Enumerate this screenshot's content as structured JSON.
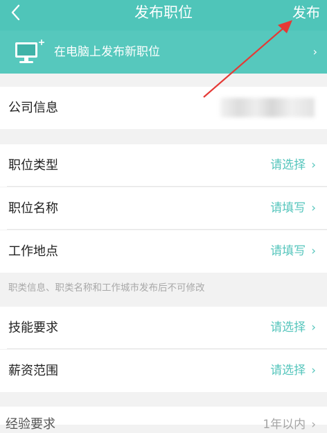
{
  "header": {
    "back_icon": "chevron-left-icon",
    "title": "发布职位",
    "publish_label": "发布"
  },
  "pc_banner": {
    "icon": "computer-monitor-icon",
    "text": "在电脑上发布新职位",
    "chevron": "›"
  },
  "company": {
    "label": "公司信息"
  },
  "form": {
    "job_type": {
      "label": "职位类型",
      "value": "请选择"
    },
    "job_name": {
      "label": "职位名称",
      "value": "请填写"
    },
    "work_location": {
      "label": "工作地点",
      "value": "请填写"
    },
    "notice": "职类信息、职类名称和工作城市发布后不可修改",
    "skills": {
      "label": "技能要求",
      "value": "请选择"
    },
    "salary": {
      "label": "薪资范围",
      "value": "请选择"
    },
    "experience": {
      "label": "经验要求",
      "value": "1年以内"
    }
  },
  "chevron": "›",
  "colors": {
    "header_bg": "#4fc5b9",
    "accent": "#55c5bc",
    "annotation_arrow": "#e53935"
  }
}
